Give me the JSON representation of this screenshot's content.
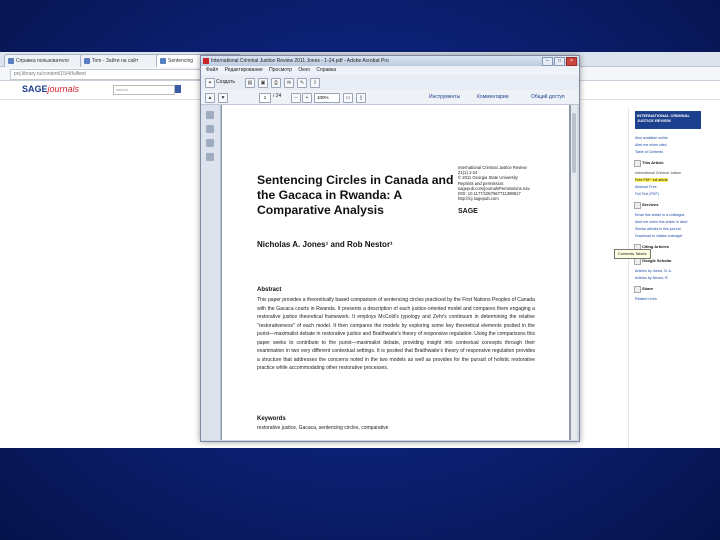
{
  "browser": {
    "tabs": [
      {
        "label": "Справка пользователя"
      },
      {
        "label": "Tom - Зайти на сайт"
      },
      {
        "label": "Sentencing"
      }
    ],
    "url": "pnj.library.ru/content/15/4/fulltext"
  },
  "site": {
    "logo_sage": "SAGE",
    "logo_journals": "journals",
    "search_placeholder": "search"
  },
  "pdf": {
    "window_title": "International Criminal Justice Review 2011 Jones - 1-24.pdf - Adobe Acrobat Pro",
    "menu": [
      "Файл",
      "Редактирование",
      "Просмотр",
      "Окно",
      "Справка"
    ],
    "toolbar_create": "Создать",
    "page_number": "1",
    "page_total": "/ 24",
    "zoom": "100%",
    "panels": [
      "Инструменты",
      "Комментарии",
      "Общий доступ"
    ],
    "meta_lines": [
      "International Criminal Justice Review",
      "21(1) 1-24",
      "© 2011 Georgia State University",
      "Reprints and permission:",
      "sagepub.com/journalsPermissions.nav",
      "DOI: 10.1177/1057567711398617",
      "http://icj.sagepub.com"
    ],
    "publisher": "SAGE",
    "title": "Sentencing Circles in Canada and the Gacaca in Rwanda: A Comparative Analysis",
    "authors": "Nicholas A. Jones¹ and Rob Nestor¹",
    "abstract_heading": "Abstract",
    "abstract": "This paper provides a theoretically based comparison of sentencing circles practiced by the First Nations Peoples of Canada with the Gacaca courts in Rwanda. It presents a description of each justice-oriented model and compares them engaging a restorative justice theoretical framework. It employs McCold's typology and Zehr's continuum in determining the relative \"restorativeness\" of each model. It then compares the models by exploring some key theoretical elements posited in the purist—maximalist debate in restorative justice and Braithwaite's theory of responsive regulation. Using the comparisons this paper seeks to contribute to the purist—maximalist debate, providing insight into contextual concepts through their examination in two very different contextual settings. It is posited that Braithwaite's theory of responsive regulation provides a structure that addresses the concerns noted in the two models as well as provides for the pursuit of holistic restorative practice while accommodating other restorative processes.",
    "keywords_heading": "Keywords",
    "keywords": "restorative justice, Gacaca, sentencing circles, comparative"
  },
  "sidebar": {
    "journal_name": "INTERNATIONAL CRIMINAL JUSTICE REVIEW",
    "lines": [
      {
        "text": "Also available online",
        "style": "lk"
      },
      {
        "text": "Alert me when cited",
        "style": "lk"
      },
      {
        "text": "Table of Contents",
        "style": "lk"
      },
      {
        "text": "This Article",
        "style": "hd"
      },
      {
        "text": "International Criminal Justice",
        "style": ""
      },
      {
        "text": "Free PDF: full article",
        "style": "hl"
      },
      {
        "text": "Abstract  Free",
        "style": "lk"
      },
      {
        "text": "Full Text (PDF)",
        "style": "lk"
      },
      {
        "text": "Services",
        "style": "hd"
      },
      {
        "text": "Email this article to a colleague",
        "style": "lk"
      },
      {
        "text": "Alert me when this article is cited",
        "style": "lk"
      },
      {
        "text": "Similar articles in this journal",
        "style": "lk"
      },
      {
        "text": "Download to citation manager",
        "style": "lk"
      },
      {
        "text": "Citing Articles",
        "style": "hd"
      },
      {
        "text": "Google Scholar",
        "style": "hd"
      },
      {
        "text": "Articles by Jones, N. A.",
        "style": "lk"
      },
      {
        "text": "Articles by Nestor, R.",
        "style": "lk"
      },
      {
        "text": "Share",
        "style": "hd"
      },
      {
        "text": "Related Links",
        "style": "lk"
      }
    ],
    "tooltip": "Contents Tables"
  }
}
